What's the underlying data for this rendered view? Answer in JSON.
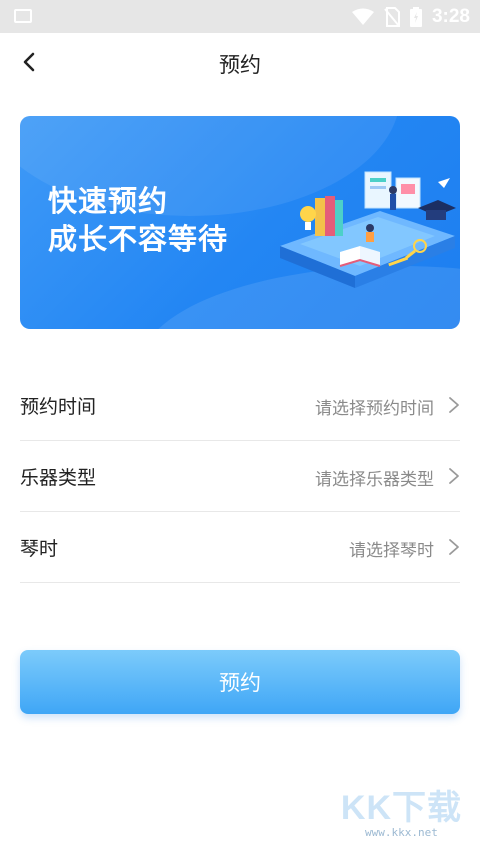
{
  "status_bar": {
    "time": "3:28"
  },
  "header": {
    "title": "预约"
  },
  "banner": {
    "line1": "快速预约",
    "line2": "成长不容等待"
  },
  "form": {
    "rows": [
      {
        "label": "预约时间",
        "placeholder": "请选择预约时间"
      },
      {
        "label": "乐器类型",
        "placeholder": "请选择乐器类型"
      },
      {
        "label": "琴时",
        "placeholder": "请选择琴时"
      }
    ]
  },
  "submit": {
    "label": "预约"
  },
  "watermark": {
    "logo": "KK下载",
    "url": "www.kkx.net"
  },
  "colors": {
    "primary": "#2386f3",
    "button": "#3fa6f6"
  }
}
